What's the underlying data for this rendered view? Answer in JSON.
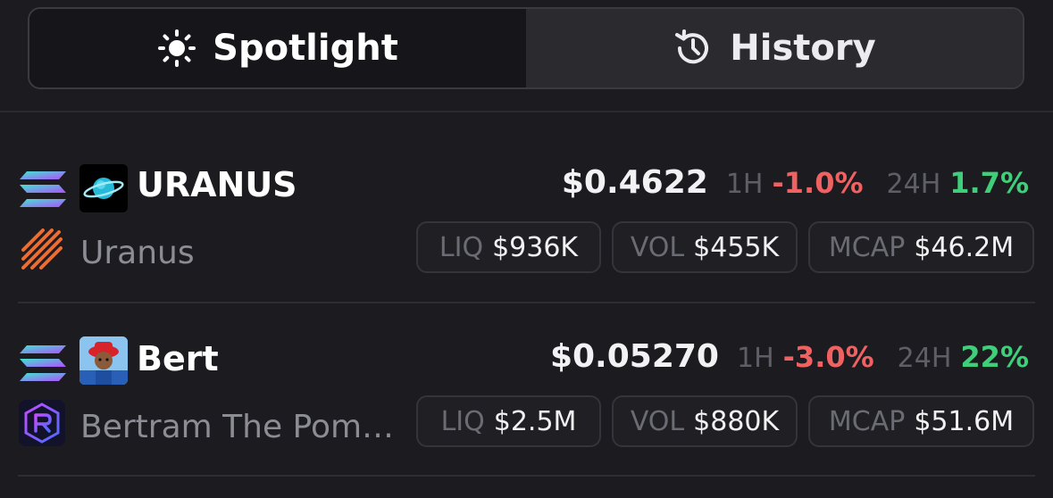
{
  "tabs": {
    "spotlight": {
      "label": "Spotlight",
      "icon": "sun-icon"
    },
    "history": {
      "label": "History",
      "icon": "history-icon"
    }
  },
  "tokens": [
    {
      "symbol": "URANUS",
      "name": "Uranus",
      "price": "$0.4622",
      "h1_label": "1H",
      "h1_change": "-1.0%",
      "h24_label": "24H",
      "h24_change": "1.7%",
      "liq_label": "LIQ",
      "liq": "$936K",
      "vol_label": "VOL",
      "vol": "$455K",
      "mcap_label": "MCAP",
      "mcap": "$46.2M",
      "chain_icon": "solana-icon",
      "dex_icon": "raydium-stripes-icon"
    },
    {
      "symbol": "Bert",
      "name": "Bertram The Pom…",
      "price": "$0.05270",
      "h1_label": "1H",
      "h1_change": "-3.0%",
      "h24_label": "24H",
      "h24_change": "22%",
      "liq_label": "LIQ",
      "liq": "$2.5M",
      "vol_label": "VOL",
      "vol": "$880K",
      "mcap_label": "MCAP",
      "mcap": "$51.6M",
      "chain_icon": "solana-icon",
      "dex_icon": "raydium-icon"
    }
  ],
  "colors": {
    "negative": "#f06262",
    "positive": "#3fcf7a",
    "background": "#1c1b20"
  }
}
